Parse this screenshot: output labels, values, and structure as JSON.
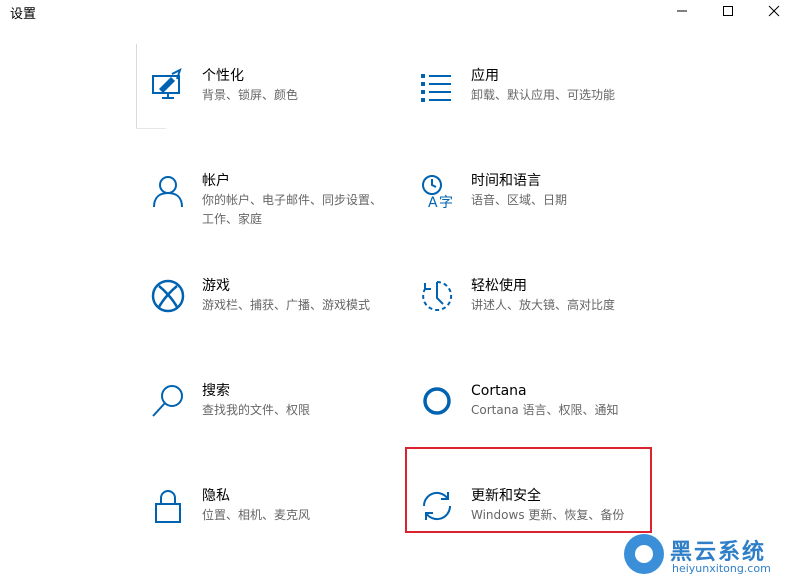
{
  "window": {
    "title": "设置"
  },
  "tiles": [
    {
      "title": "个性化",
      "desc": "背景、锁屏、颜色",
      "icon": "personalization-icon"
    },
    {
      "title": "应用",
      "desc": "卸载、默认应用、可选功能",
      "icon": "apps-icon"
    },
    {
      "title": "帐户",
      "desc": "你的帐户、电子邮件、同步设置、工作、家庭",
      "icon": "account-icon"
    },
    {
      "title": "时间和语言",
      "desc": "语音、区域、日期",
      "icon": "time-language-icon"
    },
    {
      "title": "游戏",
      "desc": "游戏栏、捕获、广播、游戏模式",
      "icon": "xbox-icon"
    },
    {
      "title": "轻松使用",
      "desc": "讲述人、放大镜、高对比度",
      "icon": "ease-of-access-icon"
    },
    {
      "title": "搜索",
      "desc": "查找我的文件、权限",
      "icon": "search-icon"
    },
    {
      "title": "Cortana",
      "desc": "Cortana 语言、权限、通知",
      "icon": "cortana-icon"
    },
    {
      "title": "隐私",
      "desc": "位置、相机、麦克风",
      "icon": "lock-icon"
    },
    {
      "title": "更新和安全",
      "desc": "Windows 更新、恢复、备份",
      "icon": "update-icon"
    }
  ],
  "accent_color": "#0063b1",
  "highlight_color": "#d9232e",
  "watermark": {
    "name": "黑云系统",
    "url": "heiyunxitong.com"
  }
}
